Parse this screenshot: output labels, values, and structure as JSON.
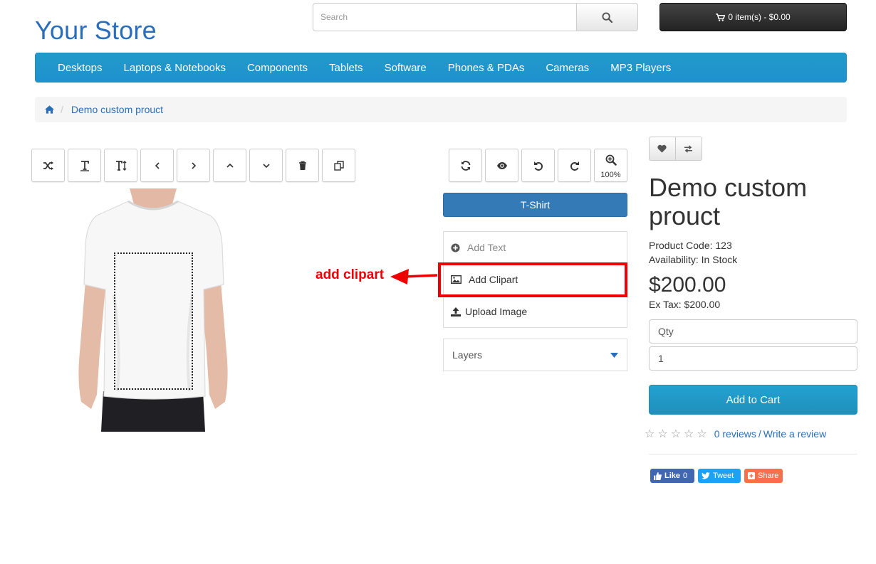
{
  "header": {
    "logo": "Your Store",
    "search_placeholder": "Search",
    "cart_label": "0 item(s) - $0.00"
  },
  "nav": {
    "items": [
      "Desktops",
      "Laptops & Notebooks",
      "Components",
      "Tablets",
      "Software",
      "Phones & PDAs",
      "Cameras",
      "MP3 Players"
    ]
  },
  "breadcrumb": {
    "current": "Demo custom prouct"
  },
  "designer": {
    "zoom": "100%",
    "product_type_button": "T-Shirt",
    "add_text": "Add Text",
    "add_clipart": "Add Clipart",
    "upload_image": "Upload Image",
    "layers": "Layers",
    "annotation": "add clipart",
    "annotation_color": "#e00000"
  },
  "product": {
    "title": "Demo custom prouct",
    "code": "Product Code: 123",
    "availability": "Availability: In Stock",
    "price": "$200.00",
    "ex_tax": "Ex Tax: $200.00",
    "qty_label": "Qty",
    "qty_value": "1",
    "add_to_cart": "Add to Cart",
    "reviews": "0 reviews",
    "review_sep": "/",
    "write_review": "Write a review"
  },
  "social": {
    "like": "Like",
    "like_count": "0",
    "tweet": "Tweet",
    "share": "Share"
  },
  "colors": {
    "brand_blue": "#229ac8",
    "link": "#2a6ebb",
    "primary_button": "#337ab7"
  }
}
